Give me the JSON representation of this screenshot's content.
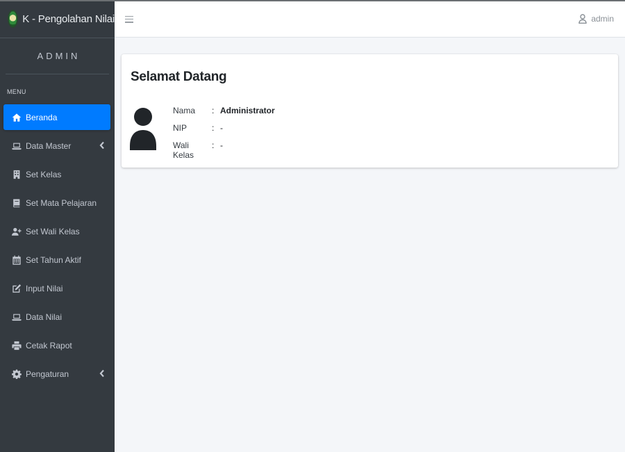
{
  "brand": {
    "title": "K - Pengolahan Nilai",
    "logo_icon": "school-emblem-icon"
  },
  "user_panel": {
    "name": "ADMIN"
  },
  "sidebar": {
    "header": "MENU",
    "items": [
      {
        "label": "Beranda",
        "icon": "home-icon",
        "active": true
      },
      {
        "label": "Data Master",
        "icon": "laptop-icon",
        "has_submenu": true
      },
      {
        "label": "Set Kelas",
        "icon": "building-icon"
      },
      {
        "label": "Set Mata Pelajaran",
        "icon": "book-icon"
      },
      {
        "label": "Set Wali Kelas",
        "icon": "user-plus-icon"
      },
      {
        "label": "Set Tahun Aktif",
        "icon": "calendar-icon"
      },
      {
        "label": "Input Nilai",
        "icon": "edit-icon"
      },
      {
        "label": "Data Nilai",
        "icon": "laptop-icon"
      },
      {
        "label": "Cetak Rapot",
        "icon": "print-icon"
      },
      {
        "label": "Pengaturan",
        "icon": "gear-icon",
        "has_submenu": true
      }
    ]
  },
  "navbar": {
    "menu_icon": "bars-icon",
    "user_label": "admin",
    "user_icon": "user-icon"
  },
  "welcome_card": {
    "title": "Selamat Datang",
    "avatar_icon": "user-avatar-icon",
    "rows": [
      {
        "label": "Nama",
        "separator": ":",
        "value": "Administrator"
      },
      {
        "label": "NIP",
        "separator": ":",
        "value": "-"
      },
      {
        "label": "Wali Kelas",
        "separator": ":",
        "value": "-"
      }
    ]
  },
  "colors": {
    "sidebar": "#343a40",
    "active": "#007bff",
    "background": "#f4f6f9"
  }
}
